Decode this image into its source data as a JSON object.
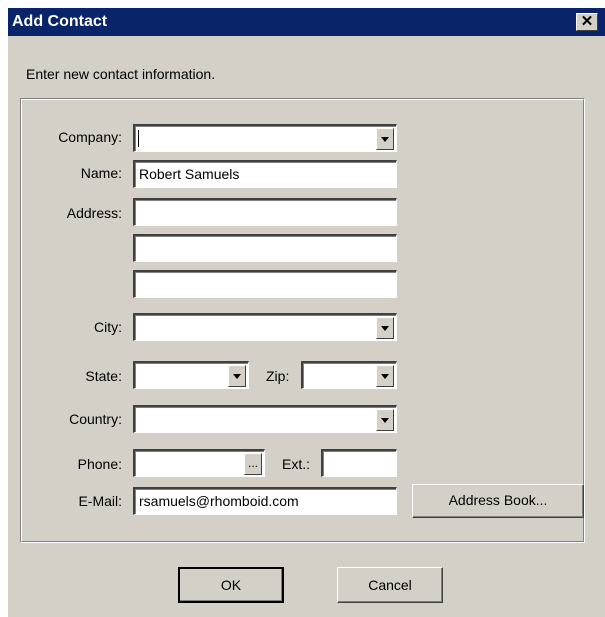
{
  "window": {
    "title": "Add Contact",
    "close_glyph": "✕"
  },
  "instruction": "Enter new contact information.",
  "labels": {
    "company": "Company:",
    "name": "Name:",
    "address": "Address:",
    "city": "City:",
    "state": "State:",
    "zip": "Zip:",
    "country": "Country:",
    "phone": "Phone:",
    "ext": "Ext.:",
    "email": "E-Mail:"
  },
  "fields": {
    "company": "",
    "name": "Robert Samuels",
    "address1": "",
    "address2": "",
    "address3": "",
    "city": "",
    "state": "",
    "zip": "",
    "country": "",
    "phone": "",
    "ext": "",
    "email": "rsamuels@rhomboid.com"
  },
  "buttons": {
    "phone_more": "...",
    "address_book": "Address Book...",
    "ok": "OK",
    "cancel": "Cancel"
  },
  "icons": {
    "close": "close-icon",
    "dropdown": "chevron-down-icon"
  }
}
